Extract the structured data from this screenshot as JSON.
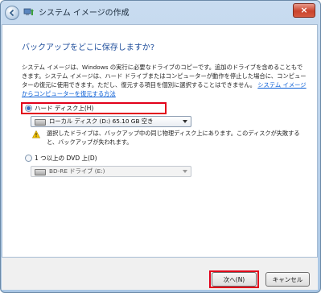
{
  "window": {
    "title": "システム イメージの作成",
    "close_label": "×"
  },
  "main": {
    "heading": "バックアップをどこに保存しますか?",
    "description": "システム イメージは、Windows の実行に必要なドライブのコピーです。追加のドライブを含めることもできます。システム イメージは、ハード ドライブまたはコンピューターが動作を停止した場合に、コンピューターの復元に使用できます。ただし、復元する項目を個別に選択することはできません。",
    "description_link": "システム イメージからコンピューターを復元する方法",
    "options": {
      "hard_disk": {
        "label": "ハード ディスク上(H)",
        "selected": true,
        "select_value": "ローカル ディスク (D:)  65.10 GB 空き",
        "warning": "選択したドライブは、バックアップ中の同じ物理ディスク上にあります。このディスクが失敗すると、バックアップが失われます。"
      },
      "dvd": {
        "label": "1 つ以上の DVD 上(D)",
        "selected": false,
        "select_value": "BD-RE ドライブ (E:)"
      }
    }
  },
  "footer": {
    "next_label": "次へ(N)",
    "cancel_label": "キャンセル"
  },
  "colors": {
    "highlight": "#e2001a",
    "heading": "#1f4e9c",
    "link": "#0a5ed6"
  },
  "icons": [
    "back-arrow-icon",
    "backup-app-icon",
    "close-icon",
    "drive-icon",
    "warning-icon",
    "dropdown-arrow-icon"
  ]
}
